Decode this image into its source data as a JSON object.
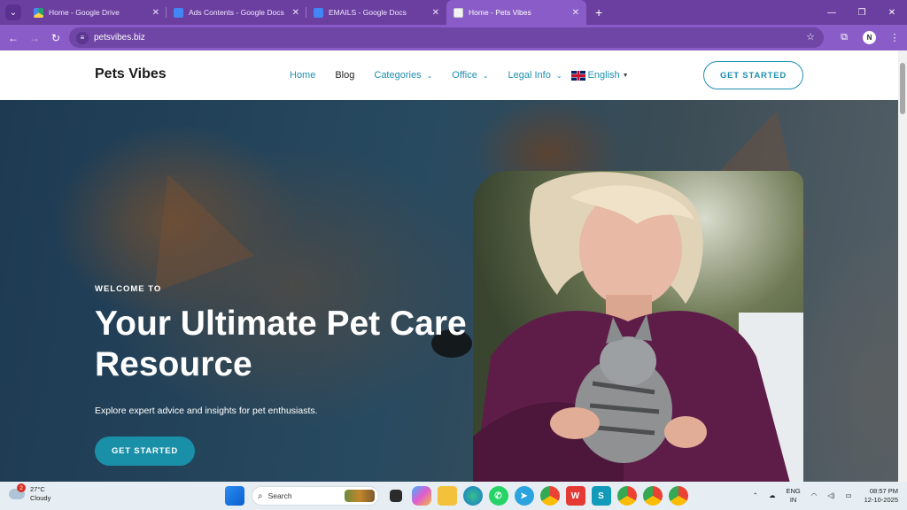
{
  "browser": {
    "tabs": [
      {
        "title": "Home - Google Drive",
        "active": false
      },
      {
        "title": "Ads Contents - Google Docs",
        "active": false
      },
      {
        "title": "EMAILS - Google Docs",
        "active": false
      },
      {
        "title": "Home - Pets Vibes",
        "active": true
      }
    ],
    "url": "petsvibes.biz",
    "profile_initial": "N",
    "colors": {
      "frame": "#6b3fa0",
      "toolbar": "#8a5cc7"
    }
  },
  "site": {
    "logo": "Pets Vibes",
    "nav": {
      "home": "Home",
      "blog": "Blog",
      "categories": "Categories",
      "office": "Office",
      "legal": "Legal Info",
      "language": "English"
    },
    "header_cta": "GET STARTED",
    "accent_color": "#1e8fb0"
  },
  "hero": {
    "eyebrow": "WELCOME TO",
    "headline": "Your Ultimate Pet Care Resource",
    "subtext": "Explore expert advice and insights for pet enthusiasts.",
    "cta": "GET STARTED"
  },
  "taskbar": {
    "weather_temp": "27°C",
    "weather_desc": "Cloudy",
    "weather_badge": "2",
    "search_placeholder": "Search",
    "lang_top": "ENG",
    "lang_bottom": "IN",
    "time": "08:57 PM",
    "date": "12-10-2025"
  }
}
